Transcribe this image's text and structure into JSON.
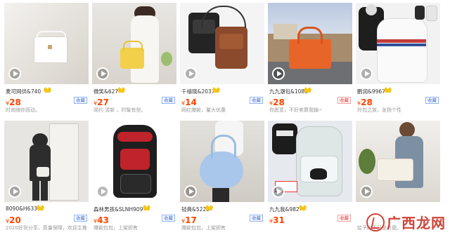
{
  "products": [
    {
      "seller": "麦可网供&740",
      "price": "28",
      "tag": "收藏",
      "desc": "时尚随你而动。",
      "bg": "#eeeae4",
      "accent": "#ffffff"
    },
    {
      "seller": "微笑&627",
      "price": "27",
      "tag": "收藏",
      "desc": "简约 清新 ，时髦有型。",
      "bg": "#e9e6e1",
      "accent": "#f2d04a"
    },
    {
      "seller": "千禧晓&2037",
      "price": "14",
      "tag": "收藏",
      "desc": "网红爆款，量大优惠",
      "bg": "#f4f4f4",
      "accent": "#8b4a2c"
    },
    {
      "seller": "九九潮包&1088",
      "price": "28",
      "tag": "收藏",
      "desc": "你愿意，不好卖算我输~",
      "bg": "#a9b8d0",
      "accent": "#e8652a"
    },
    {
      "seller": "鹏润&9967",
      "price": "28",
      "tag": "收藏",
      "desc": "拎包之族，张扬个性",
      "bg": "#f2f2f2",
      "accent": "#c43b3b"
    },
    {
      "seller": "8090&H633",
      "price": "20",
      "tag": "收藏",
      "desc": "2020好货分享，质量保障，欢迎主推。",
      "bg": "#e7e5e2",
      "accent": "#2d2d2d"
    },
    {
      "seller": "森林男孩&SLNH909",
      "price": "43",
      "tag": "收藏",
      "desc": "爆款包包，上架即售",
      "bg": "#ffffff",
      "accent": "#c0232a"
    },
    {
      "seller": "轻典&5225",
      "price": "17",
      "tag": "收藏",
      "desc": "爆款包包，上架即售",
      "bg": "#dcdad6",
      "accent": "#a9c7ea"
    },
    {
      "seller": "九九我&982",
      "price": "31",
      "tag": "收藏",
      "desc": "",
      "bg": "#e6e9ee",
      "accent": "#dfe6e6"
    },
    {
      "seller": "",
      "price": "",
      "tag": "",
      "desc": "给予的不只是方便。",
      "bg": "#eceae6",
      "accent": "#e7e2d9"
    }
  ],
  "currency_symbol": "¥",
  "play_icon": "play-icon",
  "crown_icon": "crown-icon",
  "watermark": {
    "text": "广西龙网",
    "icon": "logo-icon"
  }
}
